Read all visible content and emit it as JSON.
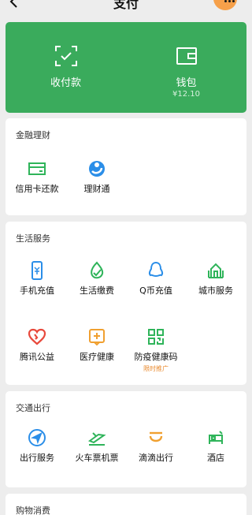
{
  "nav": {
    "title": "支付",
    "back_icon": "chevron-left-icon",
    "more_icon": "more-dots-icon"
  },
  "wallet_panel": {
    "receive": {
      "label": "收付款",
      "icon": "scan-check-icon"
    },
    "wallet": {
      "label": "钱包",
      "balance": "¥12.10",
      "icon": "wallet-icon"
    }
  },
  "finance": {
    "title": "金融理财",
    "items": [
      {
        "label": "信用卡还款",
        "icon": "credit-card-icon"
      },
      {
        "label": "理财通",
        "icon": "wealth-icon"
      }
    ]
  },
  "life": {
    "title": "生活服务",
    "items": [
      {
        "label": "手机充值",
        "icon": "phone-topup-icon"
      },
      {
        "label": "生活缴费",
        "icon": "utility-leaf-icon"
      },
      {
        "label": "Q币充值",
        "icon": "qq-penguin-icon"
      },
      {
        "label": "城市服务",
        "icon": "city-building-icon"
      },
      {
        "label": "腾讯公益",
        "icon": "charity-heart-icon"
      },
      {
        "label": "医疗健康",
        "icon": "medical-plus-icon"
      },
      {
        "label": "防疫健康码",
        "icon": "qr-code-icon",
        "tag": "限时推广"
      }
    ]
  },
  "transport": {
    "title": "交通出行",
    "items": [
      {
        "label": "出行服务",
        "icon": "navigation-icon"
      },
      {
        "label": "火车票机票",
        "icon": "train-plane-icon"
      },
      {
        "label": "滴滴出行",
        "icon": "didi-icon"
      },
      {
        "label": "酒店",
        "icon": "hotel-bed-icon"
      }
    ]
  },
  "shopping": {
    "title": "购物消费"
  },
  "colors": {
    "brand_green": "#3aab5c",
    "icon_green": "#2fb45a",
    "icon_blue": "#2b8ee8",
    "icon_orange": "#f0a030",
    "icon_red": "#e8493c",
    "more_button": "#f6a04a"
  }
}
